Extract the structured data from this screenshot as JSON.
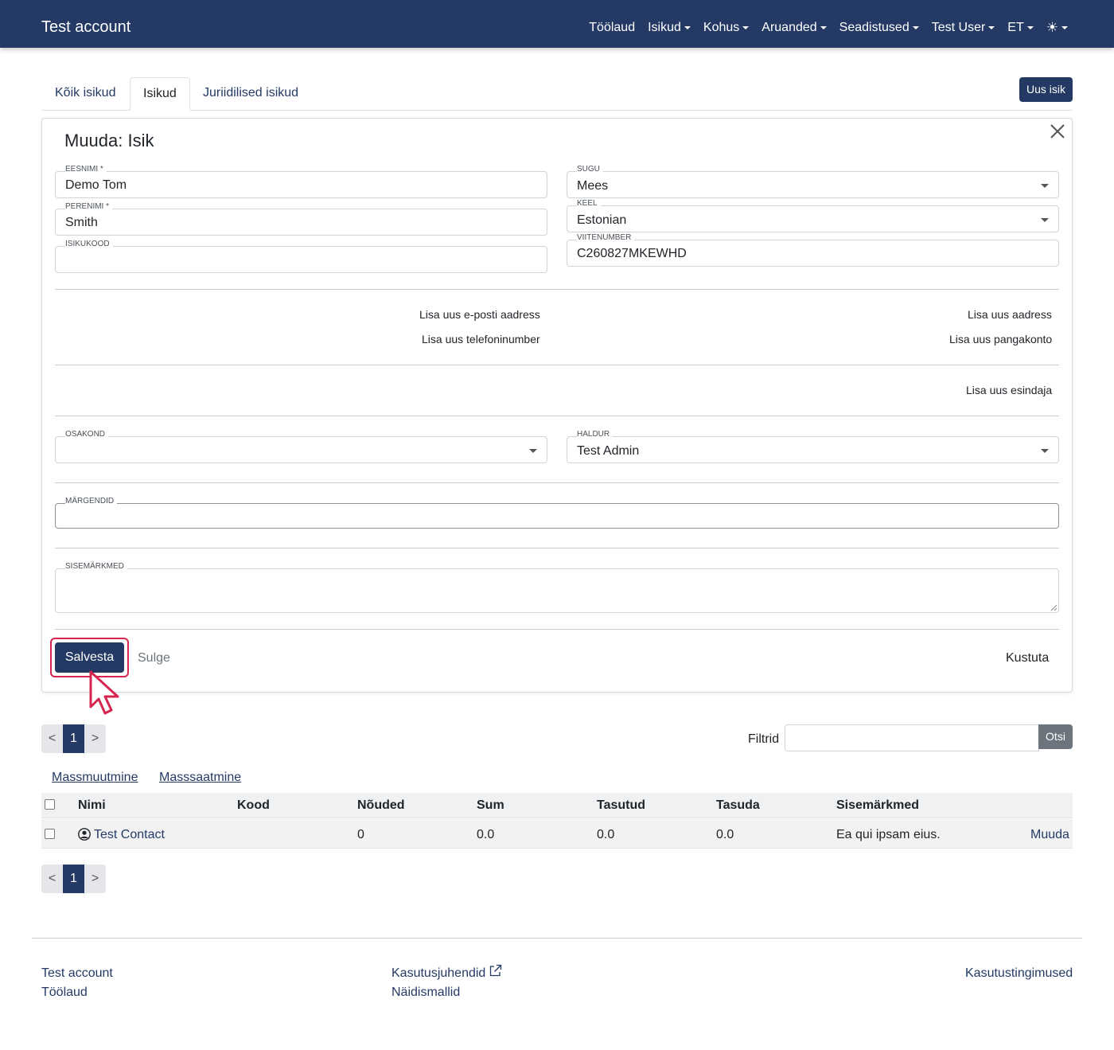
{
  "navbar": {
    "brand": "Test account",
    "items": [
      {
        "label": "Töölaud",
        "dropdown": false
      },
      {
        "label": "Isikud",
        "dropdown": true
      },
      {
        "label": "Kohus",
        "dropdown": true
      },
      {
        "label": "Aruanded",
        "dropdown": true
      },
      {
        "label": "Seadistused",
        "dropdown": true
      },
      {
        "label": "Test User",
        "dropdown": true
      },
      {
        "label": "ET",
        "dropdown": true
      }
    ],
    "theme_icon": "sun-icon",
    "theme_glyph": "☀"
  },
  "tabs": [
    {
      "label": "Kõik isikud",
      "active": false
    },
    {
      "label": "Isikud",
      "active": true
    },
    {
      "label": "Juriidilised isikud",
      "active": false
    }
  ],
  "new_button": "Uus isik",
  "form": {
    "title": "Muuda: Isik",
    "eesnimi": {
      "label": "EESNIMI *",
      "value": "Demo Tom"
    },
    "perenimi": {
      "label": "PERENIMI *",
      "value": "Smith"
    },
    "isikukood": {
      "label": "ISIKUKOOD",
      "value": ""
    },
    "sugu": {
      "label": "SUGU",
      "value": "Mees"
    },
    "keel": {
      "label": "KEEL",
      "value": "Estonian"
    },
    "viitenumber": {
      "label": "VIITENUMBER",
      "value": "C260827MKEWHD"
    },
    "add_email": "Lisa uus e-posti aadress",
    "add_phone": "Lisa uus telefoninumber",
    "add_address": "Lisa uus aadress",
    "add_bank": "Lisa uus pangakonto",
    "add_rep": "Lisa uus esindaja",
    "osakond": {
      "label": "OSAKOND",
      "value": ""
    },
    "haldur": {
      "label": "HALDUR",
      "value": "Test Admin"
    },
    "margendid": {
      "label": "MÄRGENDID",
      "value": ""
    },
    "sisemarkmed": {
      "label": "SISEMÄRKMED",
      "value": ""
    },
    "save": "Salvesta",
    "close": "Sulge",
    "delete": "Kustuta"
  },
  "pagination": {
    "prev": "<",
    "page": "1",
    "next": ">"
  },
  "filter": {
    "label": "Filtrid",
    "button": "Otsi",
    "value": ""
  },
  "actions": {
    "mass_edit": "Massmuutmine",
    "mass_send": "Masssaatmine"
  },
  "table": {
    "headers": [
      "Nimi",
      "Kood",
      "Nõuded",
      "Sum",
      "Tasutud",
      "Tasuda",
      "Sisemärkmed"
    ],
    "rows": [
      {
        "nimi": "Test Contact",
        "kood": "",
        "nouded": "0",
        "sum": "0.0",
        "tasutud": "0.0",
        "tasuda": "0.0",
        "sisemarkmed": "Ea qui ipsam eius.",
        "action": "Muuda"
      }
    ]
  },
  "footer": {
    "col1": [
      "Test account",
      "Töölaud"
    ],
    "col2": [
      "Kasutusjuhendid",
      "Näidismallid"
    ],
    "col3": [
      "Kasutustingimused"
    ]
  },
  "colors": {
    "primary": "#243a64",
    "highlight": "#d6264f",
    "secondary": "#6c757d"
  }
}
